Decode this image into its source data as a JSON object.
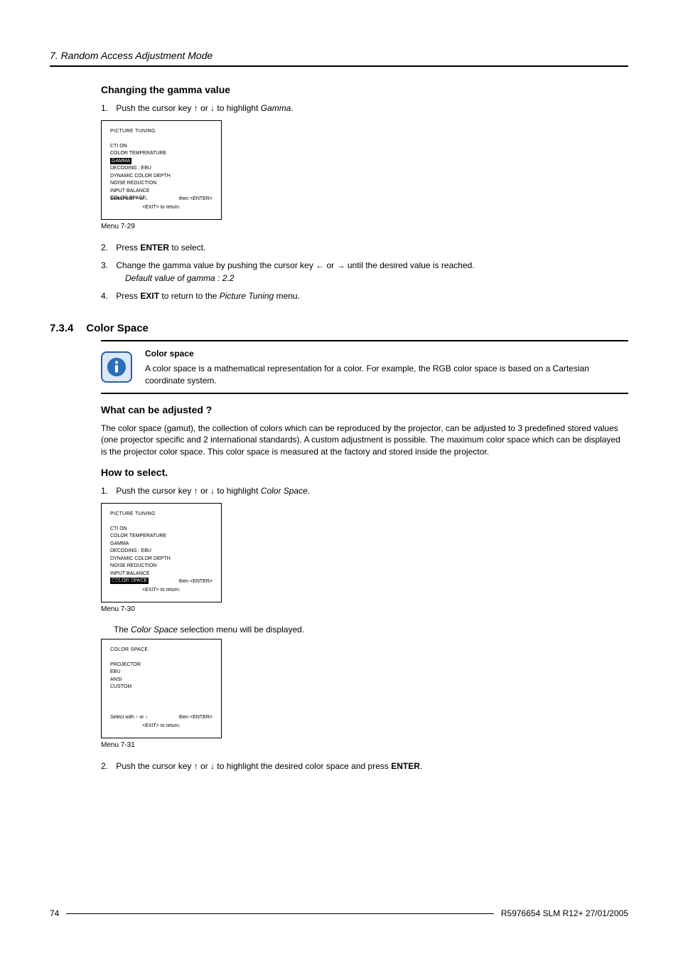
{
  "chapter": "7. Random Access Adjustment Mode",
  "section1": {
    "heading": "Changing the gamma value",
    "step1_pre": "Push the cursor key ↑ or ↓ to highlight ",
    "step1_em": "Gamma",
    "step1_post": ".",
    "menu29": {
      "title": "PICTURE TUNING",
      "items": [
        "CTI ON",
        "COLOR TEMPERATURE",
        "GAMMA",
        "DECODING : EBU",
        "DYNAMIC COLOR DEPTH",
        "NOISE REDUCTION",
        "INPUT BALANCE",
        "COLOR SPACE"
      ],
      "hl_index": 2,
      "nav_l": "Select with ↑ or ↓",
      "nav_r": "then <ENTER>",
      "nav_c": "<EXIT> to return.",
      "caption": "Menu 7-29"
    },
    "step2_pre": "Press ",
    "step2_bold": "ENTER",
    "step2_post": " to select.",
    "step3": "Change the gamma value by pushing the cursor key ← or → until the desired value is reached.",
    "step3_note": "Default value of gamma : 2.2",
    "step4_pre": "Press ",
    "step4_bold": "EXIT",
    "step4_mid": " to return to the ",
    "step4_em": "Picture Tuning",
    "step4_post": " menu."
  },
  "section2": {
    "num": "7.3.4",
    "title": "Color Space",
    "info_title": "Color space",
    "info_body": "A color space is a mathematical representation for a color. For example, the RGB color space is based on a Cartesian coordinate system.",
    "what_heading": "What can be adjusted ?",
    "what_body": "The color space (gamut), the collection of colors which can be reproduced by the projector, can be adjusted to 3 predefined stored values (one projector specific and 2 international standards). A custom adjustment is possible. The maximum color space which can be displayed is the projector color space. This color space is measured at the factory and stored inside the projector.",
    "how_heading": "How to select.",
    "how_step1_pre": "Push the cursor key ↑ or ↓ to highlight ",
    "how_step1_em": "Color Space",
    "how_step1_post": ".",
    "menu30": {
      "title": "PICTURE TUNING",
      "items": [
        "CTI ON",
        "COLOR TEMPERATURE",
        "GAMMA",
        "DECODING : EBU",
        "DYNAMIC COLOR DEPTH",
        "NOISE REDUCTION",
        "INPUT BALANCE",
        "COLOR SPACE"
      ],
      "hl_index": 7,
      "nav_l": "Select with ↑ or ↓",
      "nav_r": "then <ENTER>",
      "nav_c": "<EXIT> to return.",
      "caption": "Menu 7-30"
    },
    "result_pre": "The ",
    "result_em": "Color Space",
    "result_post": " selection menu will be displayed.",
    "menu31": {
      "title": "COLOR SPACE",
      "items": [
        "PROJECTOR",
        "EBU",
        "ANSI",
        "CUSTOM"
      ],
      "nav_l": "Select with ↑ or ↓",
      "nav_r": "then <ENTER>",
      "nav_c": "<EXIT> to return.",
      "caption": "Menu 7-31"
    },
    "how_step2_pre": "Push the cursor key ↑ or ↓ to highlight the desired color space and press ",
    "how_step2_bold": "ENTER",
    "how_step2_post": "."
  },
  "footer": {
    "page": "74",
    "doc": "R5976654 SLM R12+ 27/01/2005"
  }
}
